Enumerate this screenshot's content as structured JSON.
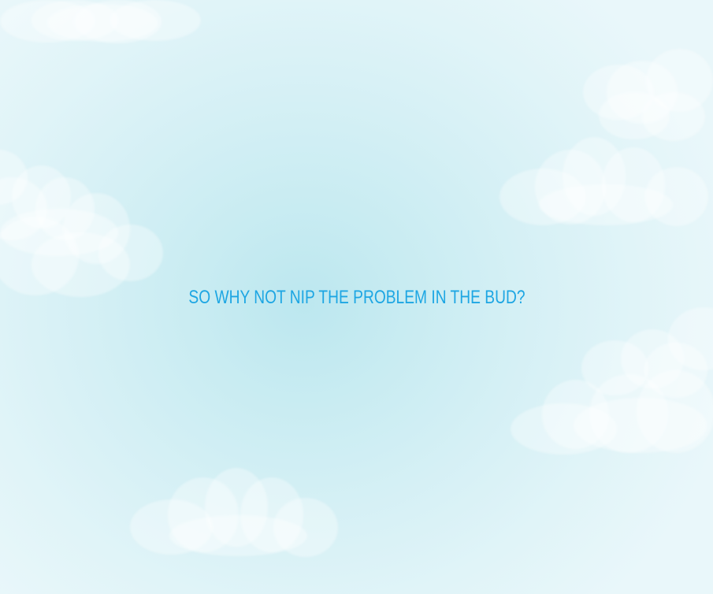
{
  "headline": {
    "text": "SO WHY NOT NIP THE PROBLEM IN THE BUD?"
  },
  "colors": {
    "headline": "#1da6e3",
    "sky_center": "#bce7ef",
    "sky_edge": "#e9f7fa",
    "cloud": "#ffffff"
  }
}
